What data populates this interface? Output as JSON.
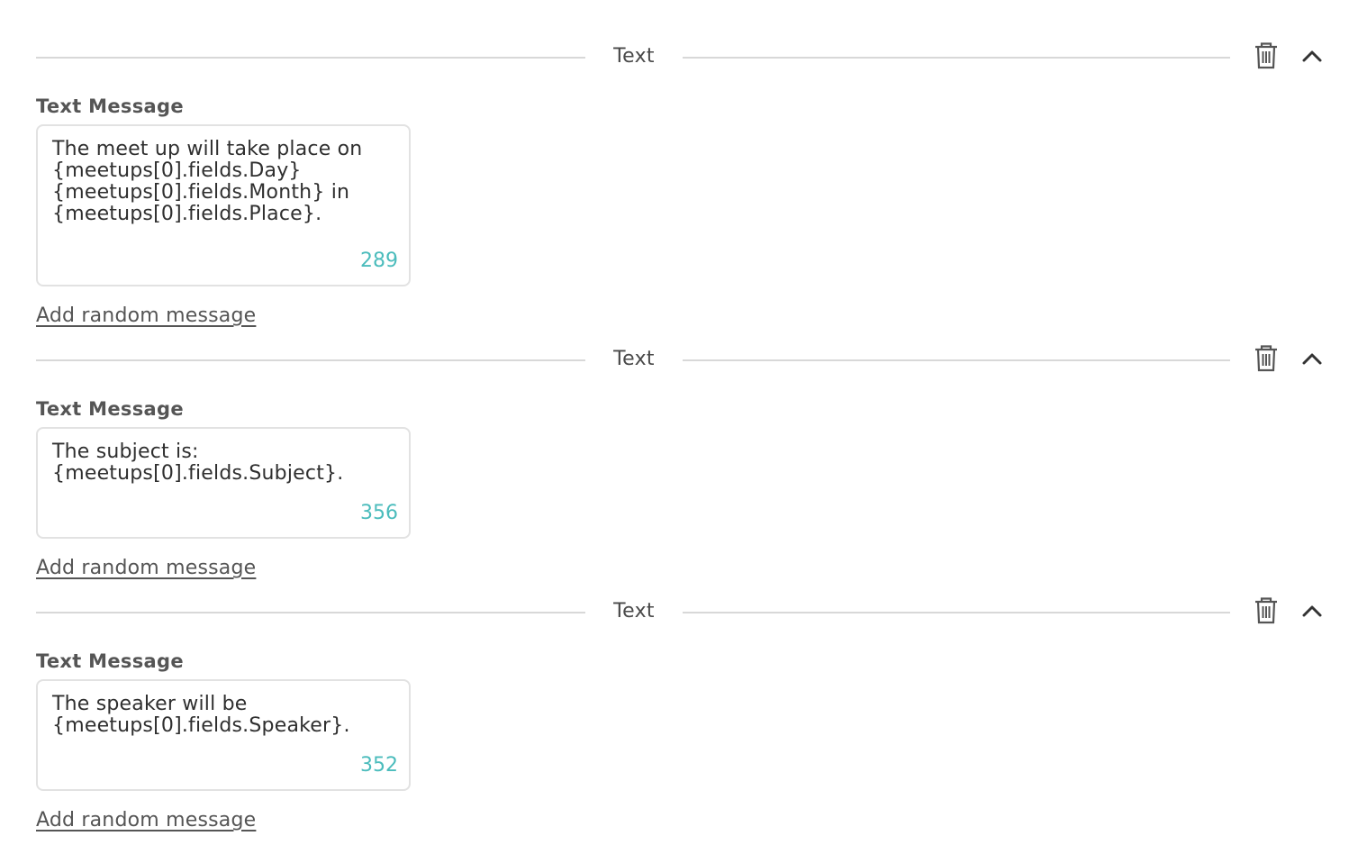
{
  "blocks": [
    {
      "title": "Text",
      "label": "Text Message",
      "message": "The meet up will take place on\n{meetups[0].fields.Day}\n{meetups[0].fields.Month} in\n{meetups[0].fields.Place}.",
      "char_count": "289",
      "add_link": "Add random message"
    },
    {
      "title": "Text",
      "label": "Text Message",
      "message": "The subject is:\n{meetups[0].fields.Subject}.",
      "char_count": "356",
      "add_link": "Add random message"
    },
    {
      "title": "Text",
      "label": "Text Message",
      "message": "The speaker will be\n{meetups[0].fields.Speaker}.",
      "char_count": "352",
      "add_link": "Add random message"
    }
  ],
  "icons": {
    "delete": "trash-icon",
    "collapse": "chevron-up-icon"
  },
  "colors": {
    "counter": "#4bbcbc",
    "divider": "#d8d8d8",
    "border": "#e2e2e2"
  }
}
